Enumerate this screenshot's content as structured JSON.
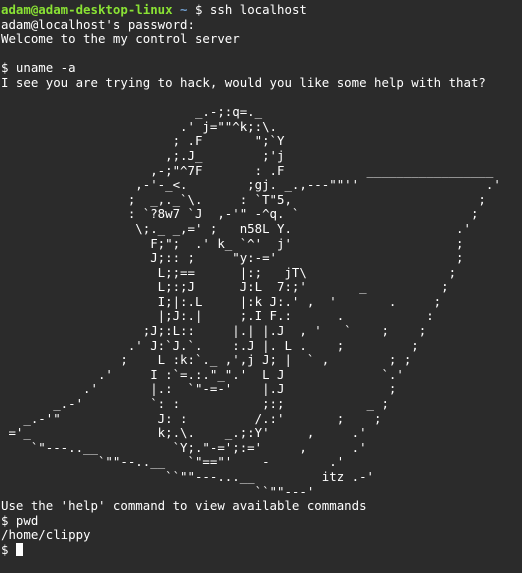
{
  "terminal": {
    "prompt": {
      "user_host": "adam@adam-desktop-linux",
      "separator": " ",
      "path": "~",
      "symbol": " $ ",
      "command": "ssh localhost"
    },
    "lines_before_art": [
      "adam@localhost's password:",
      "Welcome to the my control server",
      "",
      "$ uname -a",
      "I see you are trying to hack, would you like some help with that?"
    ],
    "ascii_art": [
      "",
      "                          _.-;:q=._",
      "                        .' j=\"\"^k;:\\.",
      "                       ; .F       \";`Y",
      "                      ,;.J_        ;'j",
      "                    ,-;\"^7F       : .F           _________________",
      "                  ,-'-_<.        ;gj. _.,---\"\"''                 .'",
      "                 ;  _,._`\\.     : `T\"5,                         ;",
      "                 : `?8w7 `J  ,-'\" -^q. `                       ;",
      "                  \\;._ _,=' ;   n58L Y.                      .'",
      "                    F;\";  .' k_ `^'  j'                      ;",
      "                    J;:: ;     \"y:-='                        ;",
      "                     L;;==      |:;   jT\\                   ;",
      "                     L;:;J      J:L  7:;'       _          ;",
      "                     I;|:.L     |:k J:.' ,  '       .     ;",
      "                     |;J:.|     ;.I F.:      .           :",
      "                   ;J;:L::     |.| |.J  , '   `    ;    ;",
      "                 .' J:`J.`.    :.J |. L .    ;         ;",
      "                ;    L :k:`._ ,',j J; |  ` ,        ; ;",
      "             .'     I :`=.:.\"_\".'  L J             `.'",
      "           .'       |.:  `\"-=-'    |.J              ;",
      "       _.-'         `: :           ;:;           _ ;",
      "   _.-'\"             J: :         /.:'       ;    ;",
      " ='_                 k;.\\.    _.;:Y'     ,     .'",
      "    `\"---..__          `Y;.\"-=';:='     ,      .'",
      "             `\"\"--..__   `\"==\"'    -        .'",
      "                      ``\"\"---...__         itz .-'",
      "                                  ``\"\"---'"
    ],
    "lines_after_art": [
      "Use the 'help' command to view available commands",
      "$ pwd",
      "/home/clippy"
    ],
    "final_prompt": "$ "
  },
  "colors": {
    "background": "#2b2b2b",
    "text": "#ffffff",
    "user_host": "#8ae234",
    "path": "#729fcf"
  }
}
